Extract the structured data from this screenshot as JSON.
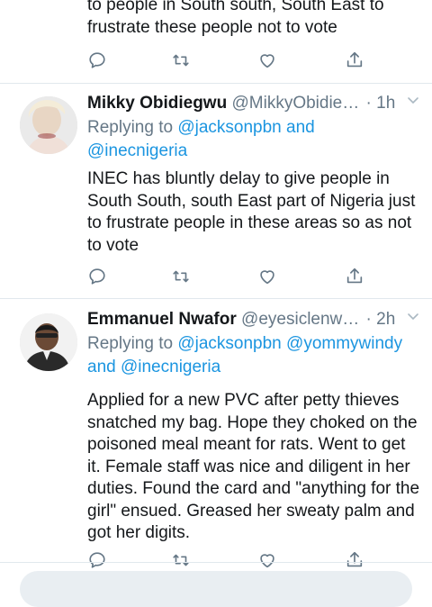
{
  "tweet_top": {
    "body_lines": [
      "to people in South south, South East to",
      "frustrate these people not to vote"
    ]
  },
  "tweet2": {
    "name": "Mikky Obidiegwu",
    "handle": "@MikkyObidie…",
    "time": "· 1h",
    "reply_prefix": "Replying to ",
    "reply_link1": "@jacksonpbn and",
    "reply_link2": "@inecnigeria",
    "body": "INEC has bluntly delay to give people in South South, south East part of Nigeria just to frustrate people in these areas so as not to vote"
  },
  "tweet3": {
    "name": "Emmanuel Nwafor",
    "handle": "@eyesiclenw…",
    "time": "· 2h",
    "reply_prefix": "Replying to ",
    "reply_link1": "@jacksonpbn @yommywindy",
    "reply_and": "and ",
    "reply_link2": "@inecnigeria",
    "body": "Applied for a new PVC after petty thieves snatched my bag. Hope they choked on the poisoned meal meant for rats. Went to get it. Female staff was nice and diligent in her duties. Found the card and \"anything for the girl\" ensued. Greased her sweaty palm and got her digits."
  },
  "icons": {
    "reply": "reply-icon",
    "retweet": "retweet-icon",
    "like": "like-icon",
    "share": "share-icon",
    "chevron": "chevron-down-icon"
  },
  "colors": {
    "link": "#1b95e0",
    "secondary": "#657786",
    "divider": "#e1e8ed"
  }
}
